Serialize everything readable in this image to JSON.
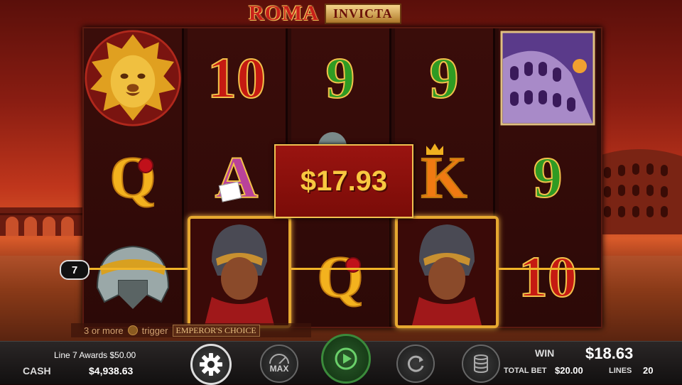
{
  "title": {
    "roma": "ROMA",
    "invicta": "INVICTA"
  },
  "reels": [
    [
      "lion-icon",
      "Q",
      "helmet-icon"
    ],
    [
      "10",
      "A",
      "gladiator-icon"
    ],
    [
      "9",
      "",
      "Q"
    ],
    [
      "9",
      "K",
      "gladiator-icon"
    ],
    [
      "colosseum-icon",
      "9",
      "10"
    ]
  ],
  "win_popup": "$17.93",
  "payline_marker": "7",
  "trigger": {
    "text_a": "3 or more",
    "text_b": "trigger",
    "badge": "EMPEROR'S CHOICE"
  },
  "bottom": {
    "message": "Line 7 Awards $50.00",
    "cash_label": "CASH",
    "cash_value": "$4,938.63",
    "max_label": "MAX",
    "win_label": "WIN",
    "win_value": "$18.63",
    "total_bet_label": "TOTAL BET",
    "total_bet_value": "$20.00",
    "lines_label": "LINES",
    "lines_value": "20"
  },
  "colors": {
    "accent": "#f0b428",
    "spin": "#3b8a3b"
  }
}
